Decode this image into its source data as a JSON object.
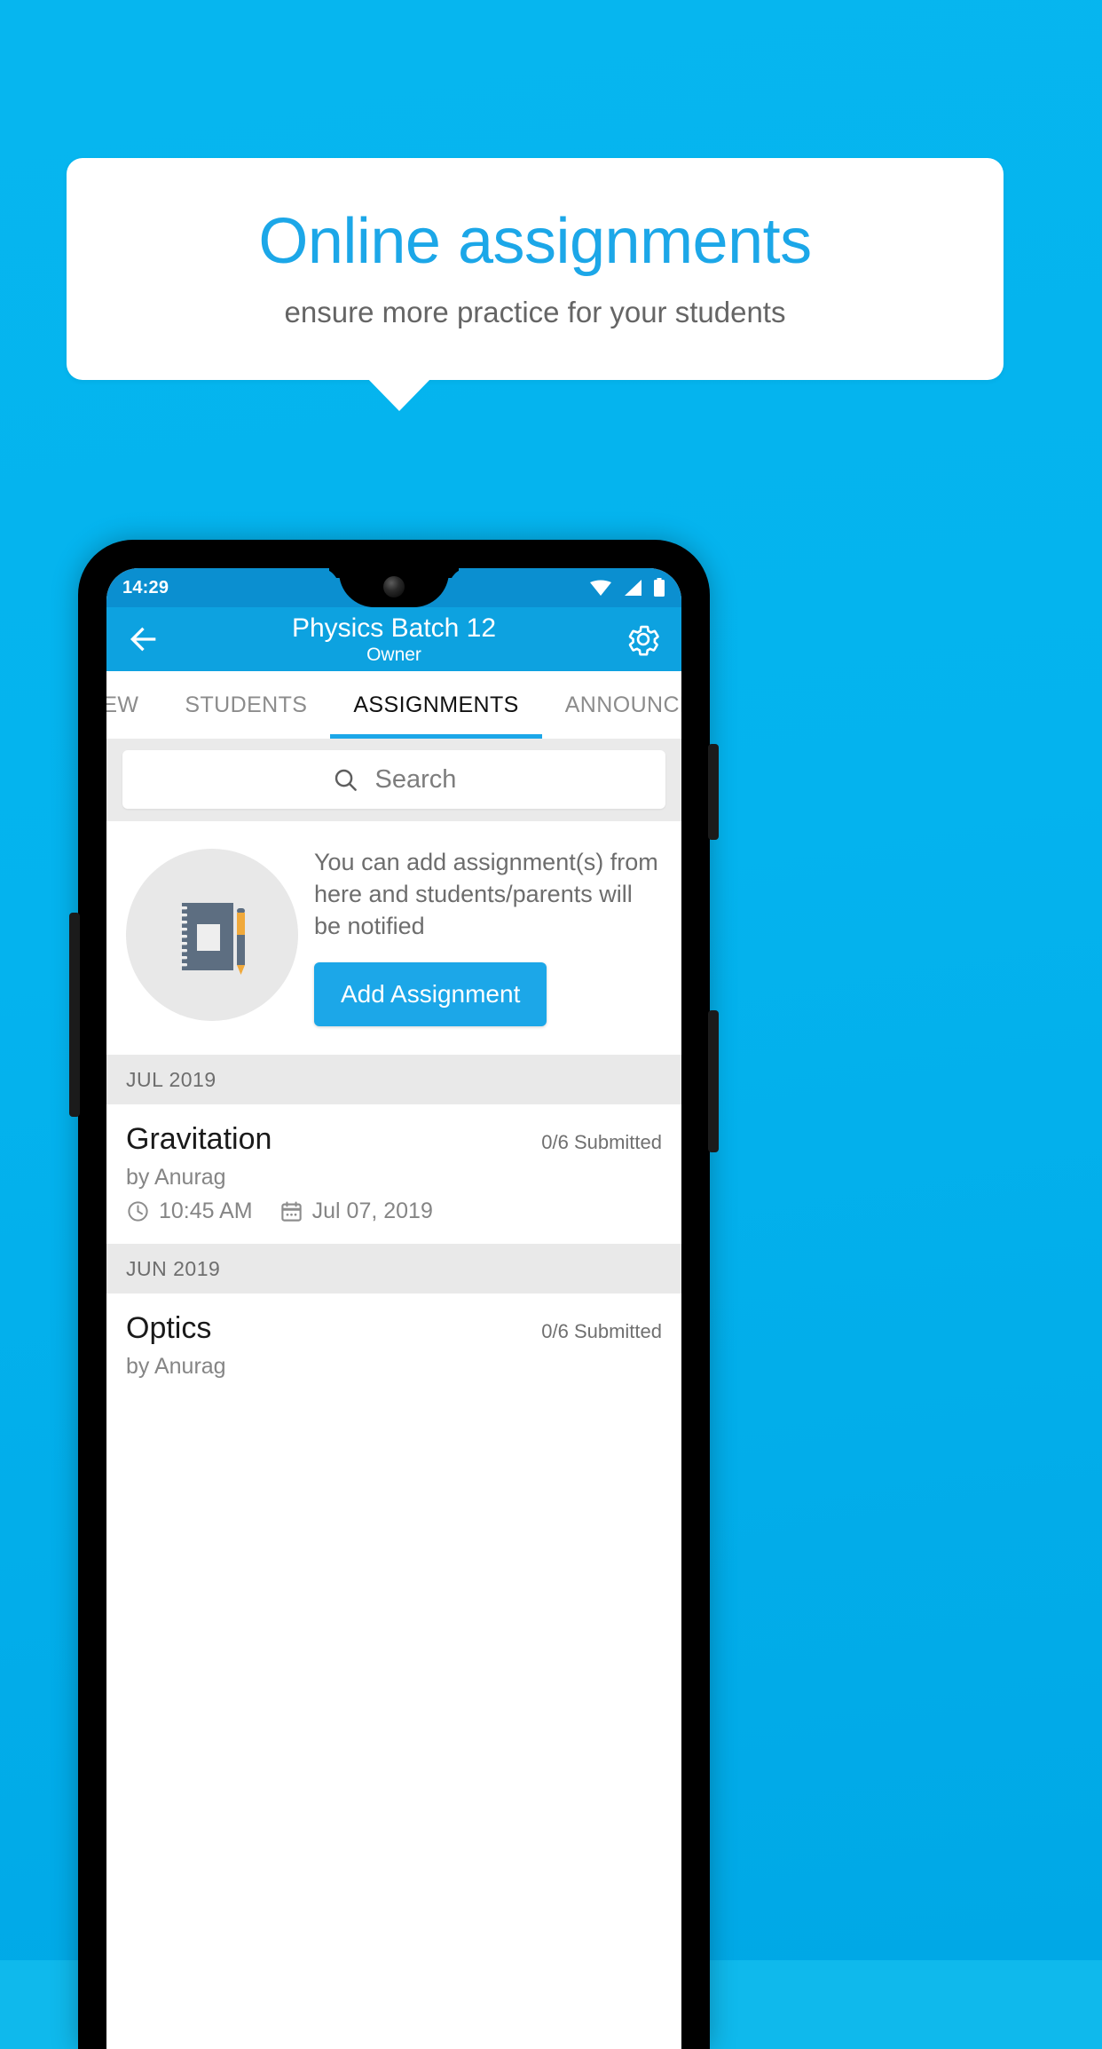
{
  "promo": {
    "title": "Online assignments",
    "subtitle": "ensure more practice for your students",
    "background_color": "#06b6ef",
    "accent_color": "#1ca7e8",
    "card_color": "#ffffff"
  },
  "phone": {
    "status_bar": {
      "time": "14:29",
      "icons": [
        "wifi-icon",
        "signal-icon",
        "battery-icon"
      ],
      "background_color": "#0b8fd0"
    },
    "app_bar": {
      "back_icon": "back-arrow-icon",
      "title": "Physics Batch 12",
      "subtitle": "Owner",
      "settings_icon": "gear-icon",
      "background_color": "#0da2e0"
    },
    "tabs": [
      {
        "label": "IEW",
        "active": false
      },
      {
        "label": "STUDENTS",
        "active": false
      },
      {
        "label": "ASSIGNMENTS",
        "active": true
      },
      {
        "label": "ANNOUNCEMENTS",
        "active": false
      }
    ],
    "search": {
      "placeholder": "Search",
      "value": "",
      "icon": "search-icon"
    },
    "empty_state": {
      "illustration": "notebook-pen-icon",
      "message": "You can add assignment(s) from here and students/parents will be notified",
      "button_label": "Add Assignment"
    },
    "groups": [
      {
        "month": "JUL 2019",
        "items": [
          {
            "title": "Gravitation",
            "submitted": "0/6 Submitted",
            "author": "by Anurag",
            "time": "10:45 AM",
            "date": "Jul 07, 2019",
            "clock_icon": "clock-icon",
            "calendar_icon": "calendar-icon"
          }
        ]
      },
      {
        "month": "JUN 2019",
        "items": [
          {
            "title": "Optics",
            "submitted": "0/6 Submitted",
            "author": "by Anurag",
            "time": "",
            "date": "",
            "clock_icon": "clock-icon",
            "calendar_icon": "calendar-icon"
          }
        ]
      }
    ]
  }
}
